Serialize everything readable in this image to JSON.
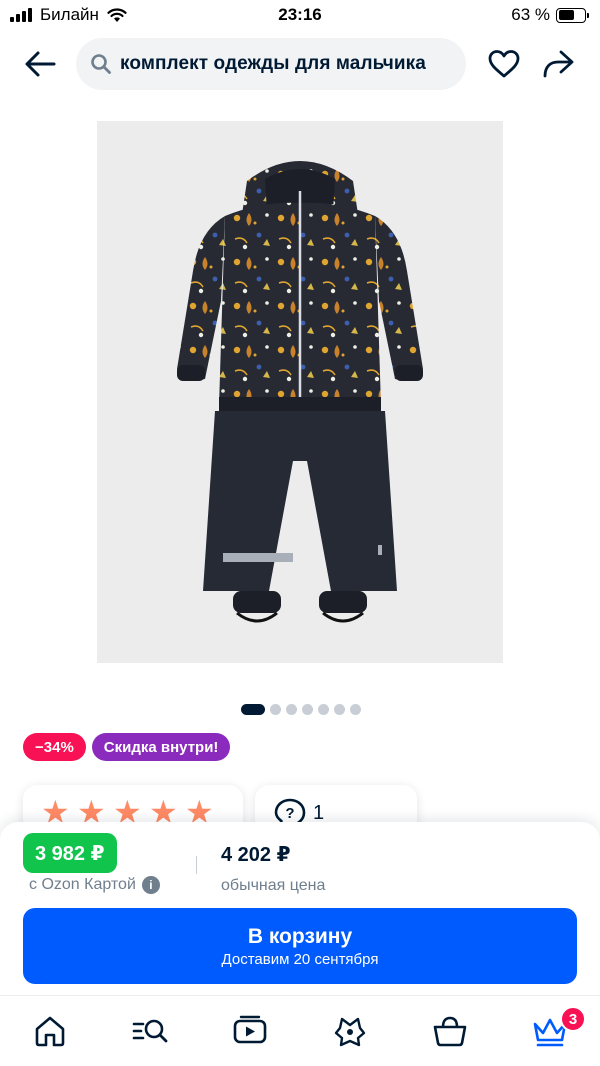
{
  "status_bar": {
    "carrier": "Билайн",
    "time": "23:16",
    "battery": "63 %",
    "battery_level": 0.63,
    "icons": [
      "signal-icon",
      "wifi-icon",
      "battery-icon"
    ]
  },
  "header": {
    "search_query": "комплект одежды для мальчика",
    "icons": [
      "back-arrow-icon",
      "search-icon",
      "heart-icon",
      "share-icon"
    ]
  },
  "gallery": {
    "total_images": 7,
    "active_index": 0
  },
  "badges": {
    "discount": "−34%",
    "promo": "Скидка внутри!"
  },
  "reviews": {
    "rating_stars": 5,
    "questions_count": "1"
  },
  "pricing": {
    "ozon_card_price": "3 982 ₽",
    "ozon_card_label": "с Ozon Картой",
    "regular_price": "4 202 ₽",
    "regular_label": "обычная цена"
  },
  "cart_button": {
    "label": "В корзину",
    "delivery": "Доставим 20 сентября"
  },
  "tab_bar": {
    "tabs": [
      "home-icon",
      "catalog-search-icon",
      "video-icon",
      "fresh-icon",
      "cart-icon",
      "premium-crown-icon"
    ],
    "premium_badge": "3",
    "active_color": "#005bff"
  },
  "colors": {
    "brand_blue": "#005bff",
    "sale_pink": "#f91155",
    "promo_purple": "#8b2bbd",
    "ozon_green": "#10c44c",
    "text_dark": "#001a34",
    "text_muted": "#707f8d"
  }
}
